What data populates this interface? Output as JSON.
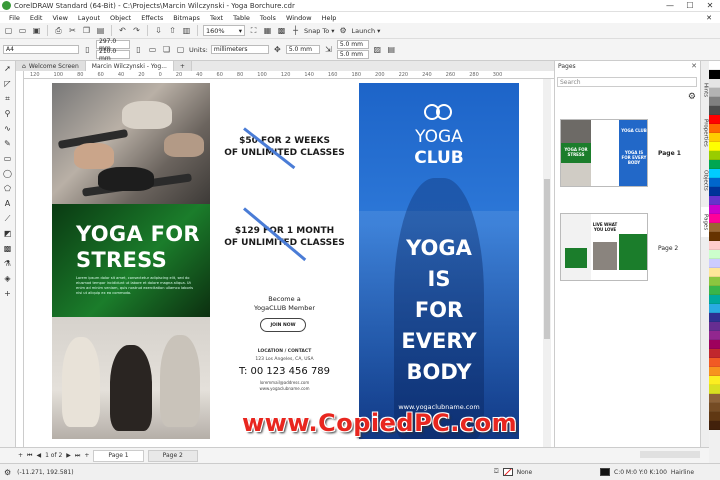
{
  "window": {
    "title": "CorelDRAW Standard (64-Bit) - C:\\Projects\\Marcin Wilczynski - Yoga Borchure.cdr",
    "minimize": "—",
    "maximize": "☐",
    "close": "✕"
  },
  "menu": {
    "items": [
      "File",
      "Edit",
      "View",
      "Layout",
      "Object",
      "Effects",
      "Bitmaps",
      "Text",
      "Table",
      "Tools",
      "Window",
      "Help"
    ],
    "close": "✕"
  },
  "standard_toolbar": {
    "zoom": "160%",
    "snap_to": "Snap To",
    "launch": "Launch"
  },
  "property_bar": {
    "page_size": "A4",
    "width": "297.0 mm",
    "height": "210.0 mm",
    "units_label": "Units:",
    "units_value": "millimeters",
    "nudge": "5.0 mm",
    "dup_x": "5.0 mm",
    "dup_y": "5.0 mm"
  },
  "document_tabs": [
    {
      "label": "Welcome Screen"
    },
    {
      "label": "Marcin Wilczynski - Yog..."
    }
  ],
  "ruler": {
    "ticks": [
      "120",
      "100",
      "80",
      "60",
      "40",
      "20",
      "0",
      "20",
      "40",
      "60",
      "80",
      "100",
      "120",
      "140",
      "160",
      "180",
      "200",
      "220",
      "240",
      "260",
      "280",
      "300"
    ],
    "unit": "millimeters"
  },
  "brochure": {
    "panel1": {
      "heading_line1": "YOGA FOR",
      "heading_line2": "STRESS",
      "body": "Lorem ipsum dolor sit amet, consectetur adipiscing elit, sed do eiusmod tempor incididunt ut labore et dolore magna aliqua. Ut enim ad minim veniam, quis nostrud exercitation ullamco laboris nisi ut aliquip ex ea commodo."
    },
    "panel2": {
      "offer1_line1": "$50 FOR 2 WEEKS",
      "offer1_line2": "OF UNLIMITED CLASSES",
      "offer2_line1": "$129 FOR 1 MONTH",
      "offer2_line2": "OF UNLIMITED CLASSES",
      "become_line1": "Become a",
      "become_line2": "YogaCLUB Member",
      "join": "JOIN NOW",
      "location_heading": "LOCATION / CONTACT",
      "address": "123 Los Angeles, CA, USA",
      "phone": "T: 00 123 456 789",
      "email": "loremmail@address.com",
      "website": "www.yogaclubname.com"
    },
    "panel3": {
      "club_line1": "YOGA",
      "club_line2": "CLUB",
      "slogan": [
        "YOGA",
        "IS",
        "FOR",
        "EVERY",
        "BODY"
      ],
      "url": "www.yogaclubname.com"
    }
  },
  "watermark": "www.CopiedPC.com",
  "pages_docker": {
    "title": "Pages",
    "search_placeholder": "Search",
    "pages": [
      {
        "label": "Page 1",
        "thumb_yoga_for_stress": "YOGA FOR STRESS",
        "thumb_yoga_club": "YOGA CLUB",
        "thumb_every_body": "YOGA IS FOR EVERY BODY"
      },
      {
        "label": "Page 2",
        "thumb_live_what": "LIVE WHAT YOU LOVE"
      }
    ]
  },
  "docker_tabs": [
    "Hints",
    "Properties",
    "Objects",
    "Pages"
  ],
  "palette_colors": [
    "#ffffff",
    "#000000",
    "#e5e5e5",
    "#b3b3b3",
    "#808080",
    "#4d4d4d",
    "#ff0000",
    "#ff6600",
    "#ffcc00",
    "#ffff00",
    "#99cc00",
    "#00a651",
    "#00ccff",
    "#0066cc",
    "#003399",
    "#6633cc",
    "#cc00cc",
    "#ff0099",
    "#996633",
    "#663300",
    "#ffcccc",
    "#ccffcc",
    "#ccccff",
    "#ffe699",
    "#8cc63f",
    "#39b54a",
    "#00a99d",
    "#29abe2",
    "#2e3192",
    "#662d91",
    "#92278f",
    "#9e005d",
    "#c1272d",
    "#f15a24",
    "#f7931e",
    "#fcee21",
    "#d9e021",
    "#8c6239",
    "#754c24",
    "#603813",
    "#42210b"
  ],
  "page_nav": {
    "counter": "1 of 2",
    "pages": [
      "Page 1",
      "Page 2"
    ]
  },
  "status": {
    "coords": "(-11.271, 192.581)",
    "fill_label": "None",
    "outline_label": "C:0 M:0 Y:0 K:100",
    "outline_width": "Hairline"
  }
}
